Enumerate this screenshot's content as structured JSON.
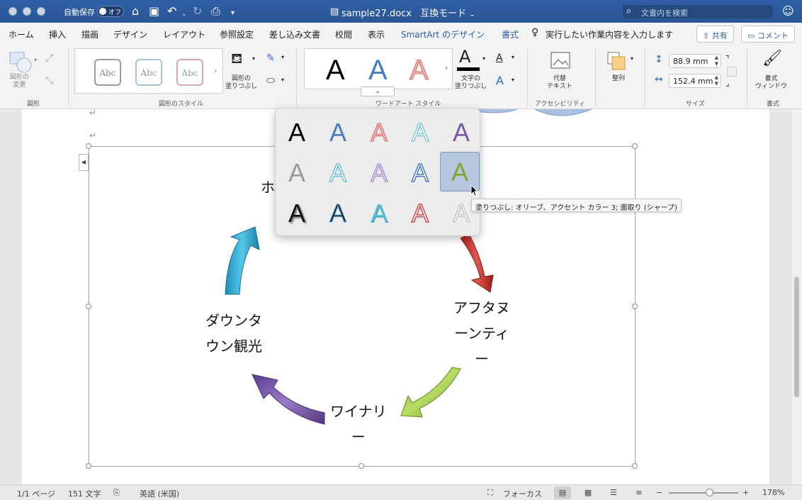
{
  "titlebar": {
    "autosave_label": "自動保存",
    "autosave_state": "オフ",
    "doc_title": "sample27.docx",
    "doc_mode": "互換モード",
    "search_placeholder": "文書内を検索"
  },
  "tabs": {
    "items": [
      "ホーム",
      "挿入",
      "描画",
      "デザイン",
      "レイアウト",
      "参照設定",
      "差し込み文書",
      "校閲",
      "表示",
      "SmartArt のデザイン",
      "書式"
    ],
    "active": "書式",
    "tell_me": "実行したい作業内容を入力します",
    "share": "共有",
    "comment": "コメント"
  },
  "ribbon": {
    "shapes_group": {
      "label": "図形",
      "change_shape": "図形の\n変更"
    },
    "shape_styles": {
      "label": "図形のスタイル",
      "swatches": [
        "Abc",
        "Abc",
        "Abc"
      ],
      "fill_label": "図形の\n塗りつぶし"
    },
    "wordart_styles": {
      "label": "ワードアート スタイル",
      "preview_glyph": "A",
      "text_fill_label": "文字の\n塗りつぶし"
    },
    "accessibility": {
      "label": "アクセシビリティ",
      "alt_text": "代替\nテキスト"
    },
    "arrange": {
      "label": "整列"
    },
    "size": {
      "label": "サイズ",
      "height": "88.9 mm",
      "width": "152.4 mm"
    },
    "format": {
      "label": "書式",
      "pane": "書式\nウィンドウ"
    }
  },
  "wordart_dropdown": {
    "glyph": "A",
    "selected_index": 9,
    "tooltip": "塗りつぶし: オリーブ、アクセント カラー 3; 面取り (シャープ)"
  },
  "diagram": {
    "labels": {
      "top": "ホ",
      "right": "アフタヌ\nーンティ\nー",
      "bottom": "ワイナリ\nー",
      "left": "ダウンタ\nウン観光"
    },
    "paragraph_mark": "↵"
  },
  "statusbar": {
    "page": "1/1 ページ",
    "words": "151 文字",
    "language": "英語 (米国)",
    "focus": "フォーカス",
    "zoom": "178%"
  }
}
